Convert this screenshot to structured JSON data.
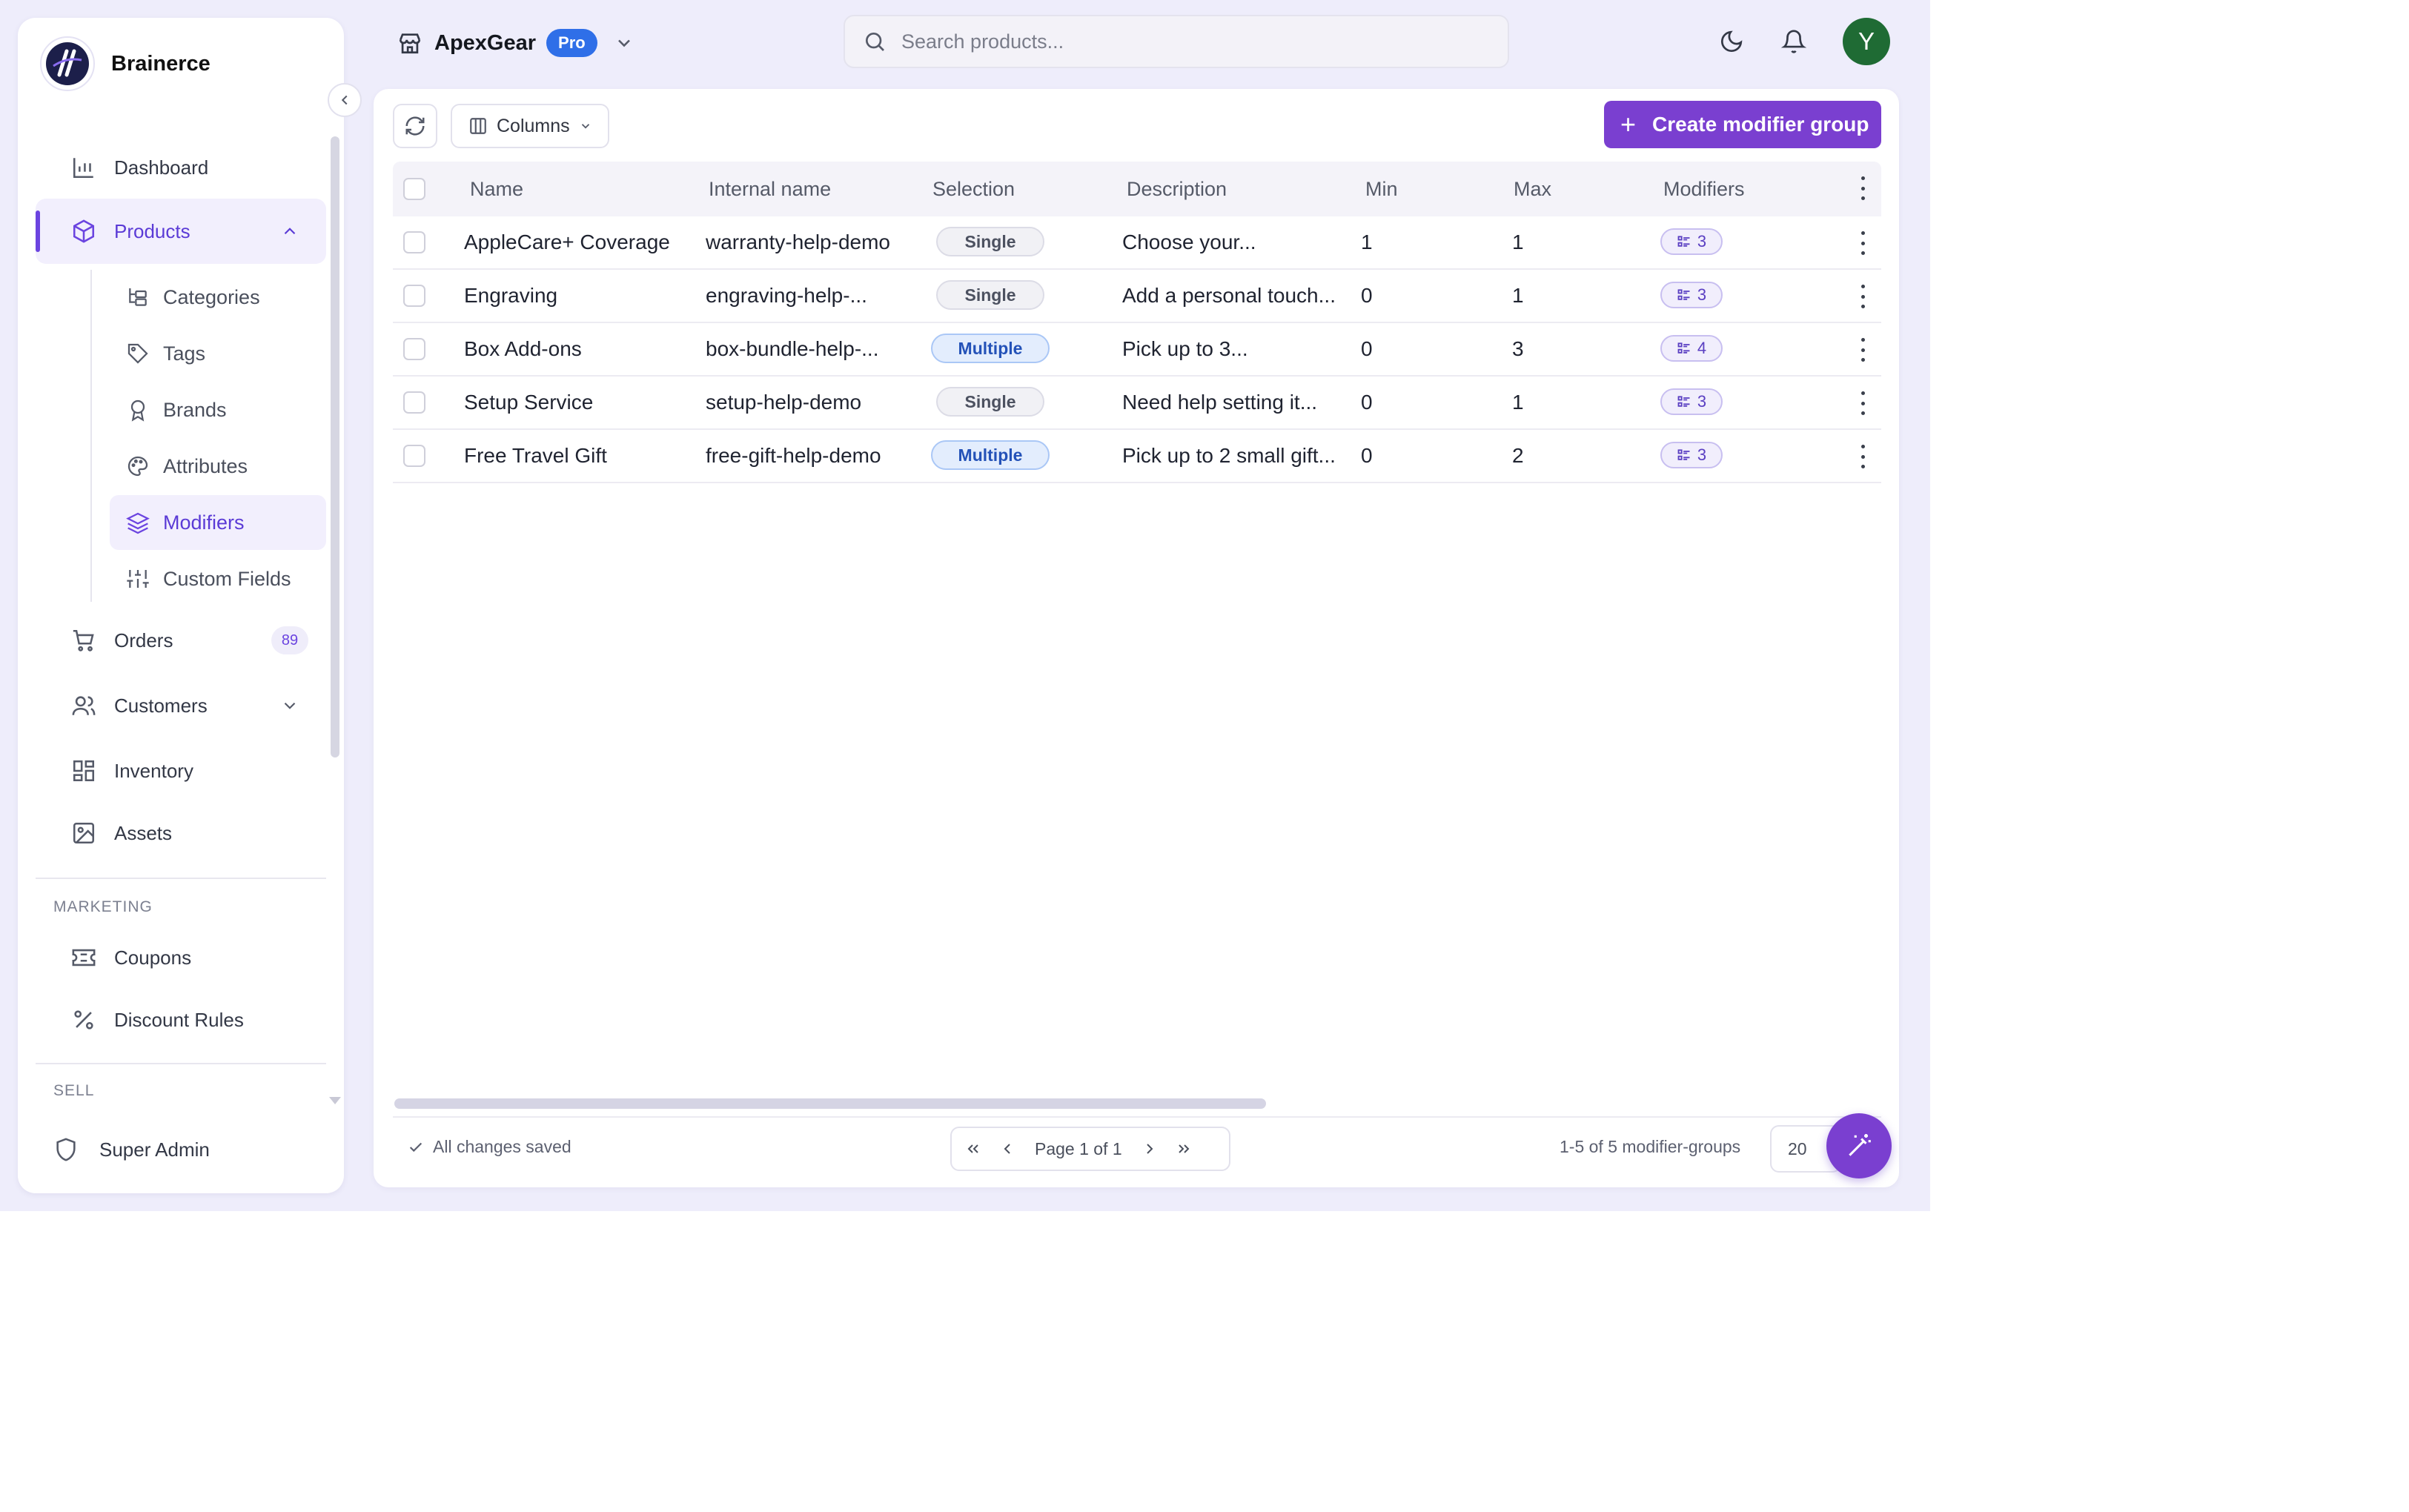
{
  "brand": {
    "name": "Brainerce"
  },
  "sidebar": {
    "nav": [
      {
        "label": "Dashboard"
      },
      {
        "label": "Products"
      },
      {
        "label": "Orders",
        "count": "89"
      },
      {
        "label": "Customers"
      },
      {
        "label": "Inventory"
      },
      {
        "label": "Assets"
      }
    ],
    "products_sub": [
      {
        "label": "Categories"
      },
      {
        "label": "Tags"
      },
      {
        "label": "Brands"
      },
      {
        "label": "Attributes"
      },
      {
        "label": "Modifiers",
        "active": true
      },
      {
        "label": "Custom Fields"
      }
    ],
    "marketing_label": "MARKETING",
    "marketing": [
      {
        "label": "Coupons"
      },
      {
        "label": "Discount Rules"
      }
    ],
    "sell_label": "SELL",
    "footer": {
      "label": "Super Admin"
    }
  },
  "topbar": {
    "store_name": "ApexGear",
    "plan_badge": "Pro",
    "search_placeholder": "Search products...",
    "avatar_initial": "Y"
  },
  "toolbar": {
    "columns_label": "Columns",
    "create_label": "Create modifier group"
  },
  "table": {
    "columns": [
      "Name",
      "Internal name",
      "Selection",
      "Description",
      "Min",
      "Max",
      "Modifiers"
    ],
    "rows": [
      {
        "name": "AppleCare+ Coverage",
        "internal": "warranty-help-demo",
        "selection": "Single",
        "description": "Choose your...",
        "min": "1",
        "max": "1",
        "modifiers": "3"
      },
      {
        "name": "Engraving",
        "internal": "engraving-help-...",
        "selection": "Single",
        "description": "Add a personal touch...",
        "min": "0",
        "max": "1",
        "modifiers": "3"
      },
      {
        "name": "Box Add-ons",
        "internal": "box-bundle-help-...",
        "selection": "Multiple",
        "description": "Pick up to 3...",
        "min": "0",
        "max": "3",
        "modifiers": "4"
      },
      {
        "name": "Setup Service",
        "internal": "setup-help-demo",
        "selection": "Single",
        "description": "Need help setting it...",
        "min": "0",
        "max": "1",
        "modifiers": "3"
      },
      {
        "name": "Free Travel Gift",
        "internal": "free-gift-help-demo",
        "selection": "Multiple",
        "description": "Pick up to 2 small gift...",
        "min": "0",
        "max": "2",
        "modifiers": "3"
      }
    ]
  },
  "footer": {
    "saved_status": "All changes saved",
    "page_label": "Page 1 of 1",
    "range_label": "1-5 of 5 modifier-groups",
    "page_size": "20"
  },
  "colors": {
    "accent": "#7a3fd0",
    "active_nav": "#5b3bd6",
    "pro_badge": "#2f6fe8",
    "avatar": "#1f6b34",
    "app_bg": "#eeedfb"
  }
}
